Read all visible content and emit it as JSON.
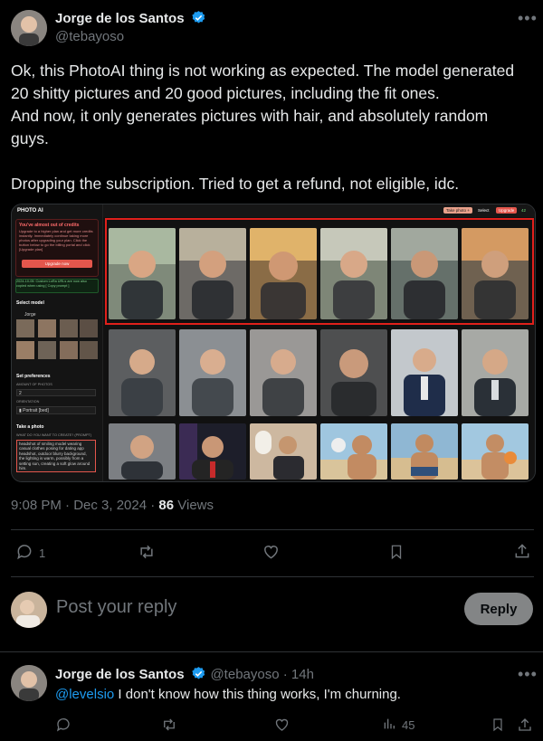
{
  "tweet": {
    "author_name": "Jorge de los Santos",
    "author_handle": "@tebayoso",
    "text_lines": [
      "Ok, this PhotoAI thing is not working as expected.  The model generated",
      "20 shitty pictures and 20 good pictures, including the fit ones.",
      "And now, it only generates pictures with hair, and absolutely random",
      "guys.",
      "",
      "Dropping the subscription. Tried to get a refund, not eligible, idc."
    ],
    "time": "9:08 PM · Dec 3, 2024 · ",
    "views_count": "86",
    "views_label": " Views",
    "reply_count": "1"
  },
  "embedded": {
    "app_logo": "PHOTO AI",
    "alert_title": "You've almost out of credits",
    "alert_body": "Upgrade to a higher plan and get more credits instantly. Immediately continue taking more photos after upgrading your plan. Click the button below to go the billing portal and click [Upgrade plan]",
    "upgrade_button": "Upgrade now",
    "notice": "2024-10-05: Custom LoRa URLs are now also copied when using [ Copy prompt ]",
    "select_model": "Select model",
    "model_name": "Jorge",
    "set_preferences": "Set preferences",
    "amount_label": "AMOUNT OF PHOTOS",
    "amount_value": "2",
    "orientation_label": "ORIENTATION",
    "orientation_value": "▮ Portrait [bed]",
    "take_photo": "Take a photo",
    "prompt_label": "WHAT DO YOU WANT TO CREATE? (PROMPT)",
    "prompt_text": "headshot of smiling model wearing casual clothes posing for dating app headshot, outdoor blurry background, the lighting is warm, possibly from a setting sun, creating a soft glow around him.",
    "top_button_1": "Take photo +",
    "top_button_2": "Select",
    "top_button_3": "Upgrade",
    "credits": "42"
  },
  "reply_box": {
    "placeholder": "Post your reply",
    "button": "Reply"
  },
  "reply_tweet": {
    "author_name": "Jorge de los Santos",
    "author_handle": "@tebayoso",
    "age": " · 14h",
    "mention": "@levelsio",
    "text": " I don't know how this thing works, I'm churning.",
    "views": "45"
  },
  "colors": {
    "background": "#000000",
    "text": "#e7e9ea",
    "muted": "#71767b",
    "link": "#1d9bf0",
    "verified": "#1d9bf0",
    "highlight_box": "#e0201b",
    "upgrade_button": "#e4564c"
  }
}
